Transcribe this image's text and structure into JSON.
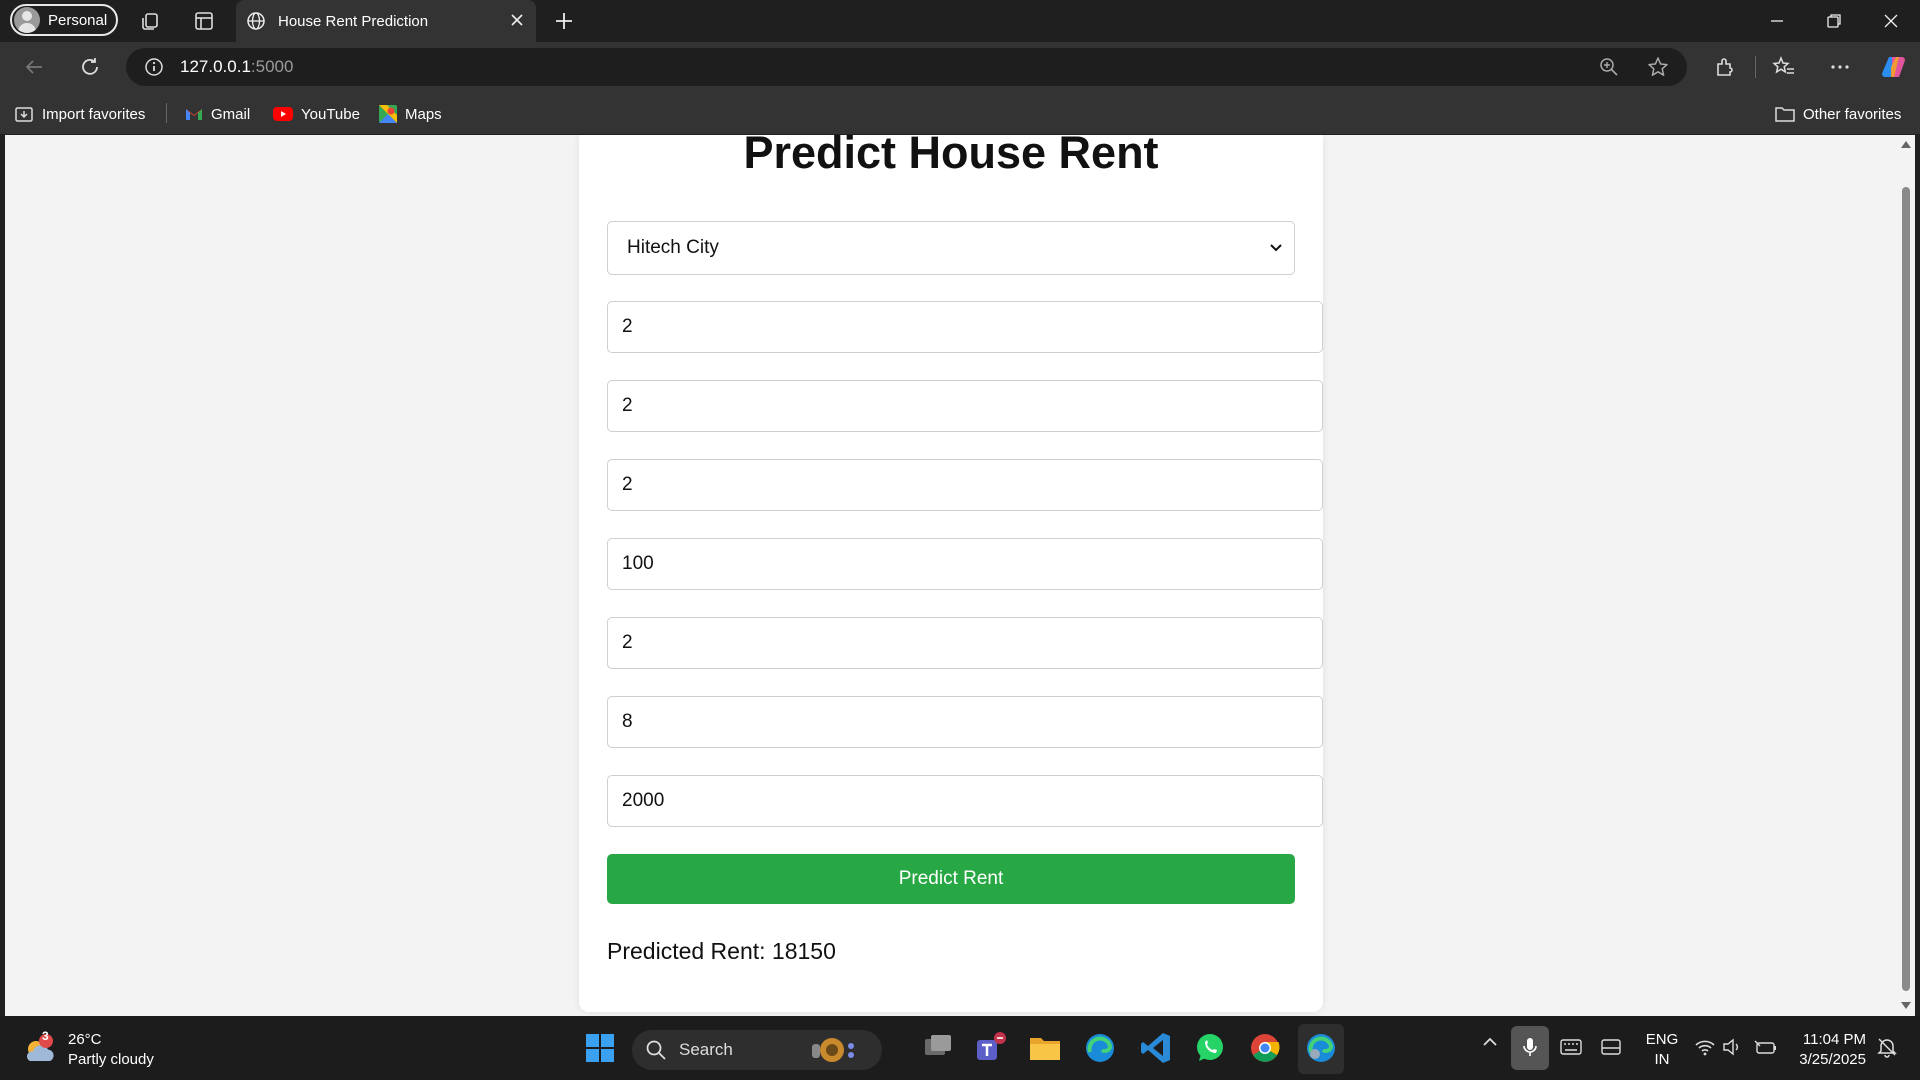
{
  "browser": {
    "profile_label": "Personal",
    "tab_title": "House Rent Prediction",
    "url_host": "127.0.0.1",
    "url_port": ":5000",
    "favorites": {
      "import": "Import favorites",
      "gmail": "Gmail",
      "youtube": "YouTube",
      "maps": "Maps",
      "other": "Other favorites"
    }
  },
  "page": {
    "heading": "Predict House Rent",
    "location_select": "Hitech City",
    "fields": [
      "2",
      "2",
      "2",
      "100",
      "2",
      "8",
      "2000"
    ],
    "submit_label": "Predict Rent",
    "result_text": "Predicted Rent: 18150"
  },
  "taskbar": {
    "weather_badge": "3",
    "temperature": "26°C",
    "condition": "Partly cloudy",
    "search_placeholder": "Search",
    "lang_top": "ENG",
    "lang_bottom": "IN",
    "time": "11:04 PM",
    "date": "3/25/2025"
  },
  "colors": {
    "accent_button": "#28a745",
    "page_background": "#f3f3f3",
    "chrome_dark": "#333333"
  }
}
